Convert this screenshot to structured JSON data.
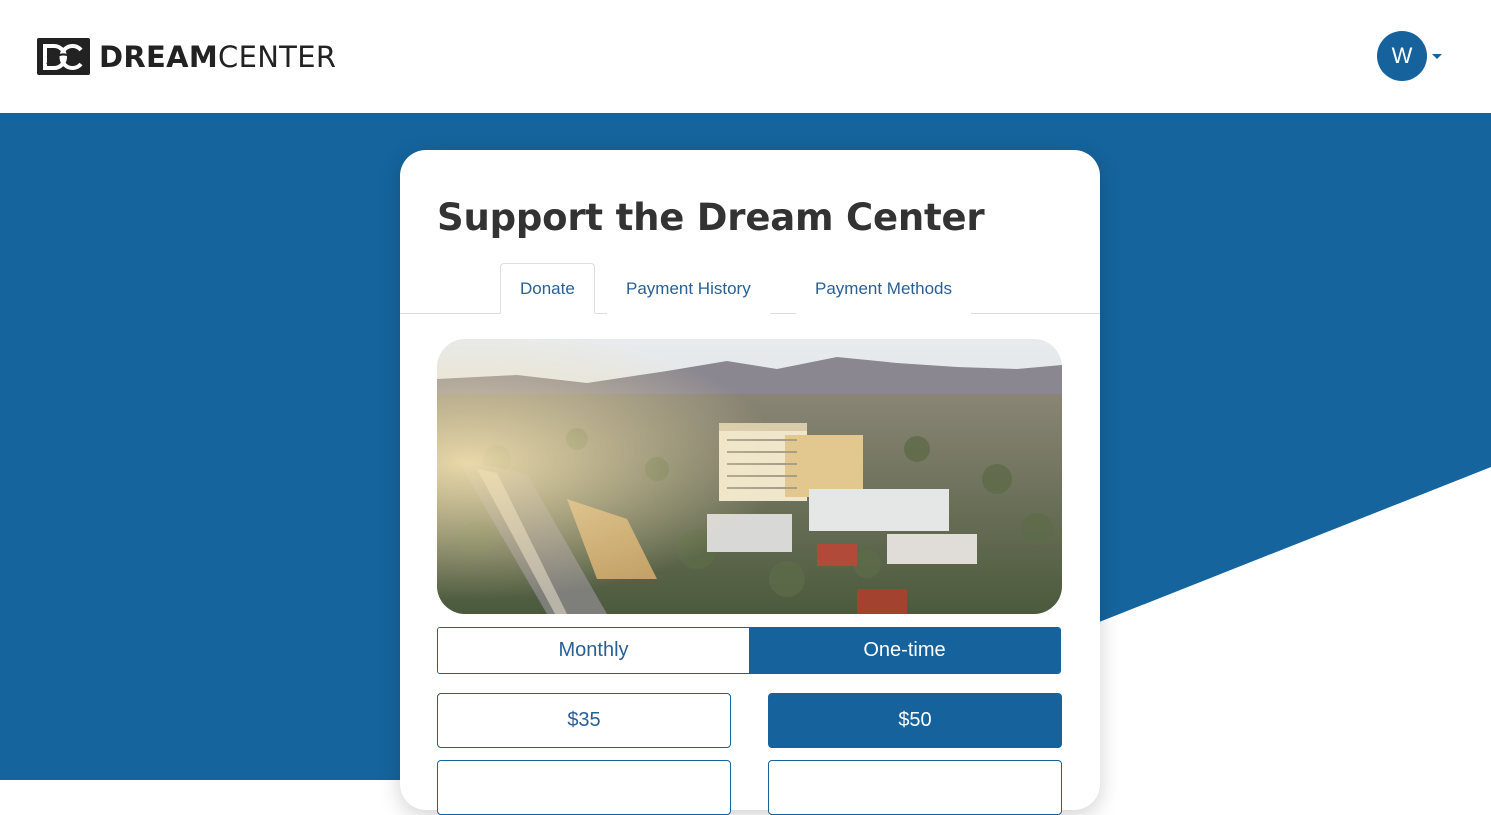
{
  "header": {
    "logo": {
      "mark": "DC",
      "text_bold": "DREAM",
      "text_light": "CENTER"
    },
    "user": {
      "initial": "W"
    }
  },
  "card": {
    "title": "Support the Dream Center",
    "tabs": [
      {
        "label": "Donate",
        "active": true
      },
      {
        "label": "Payment History",
        "active": false
      },
      {
        "label": "Payment Methods",
        "active": false
      }
    ],
    "hero_image": "city-aerial-photo",
    "frequency": {
      "options": [
        "Monthly",
        "One-time"
      ],
      "selected": "One-time"
    },
    "amounts": [
      {
        "label": "$35",
        "selected": false
      },
      {
        "label": "$50",
        "selected": true
      }
    ]
  },
  "colors": {
    "brand_blue": "#15629c",
    "background_blue": "#15649d",
    "title_text": "#333333"
  }
}
